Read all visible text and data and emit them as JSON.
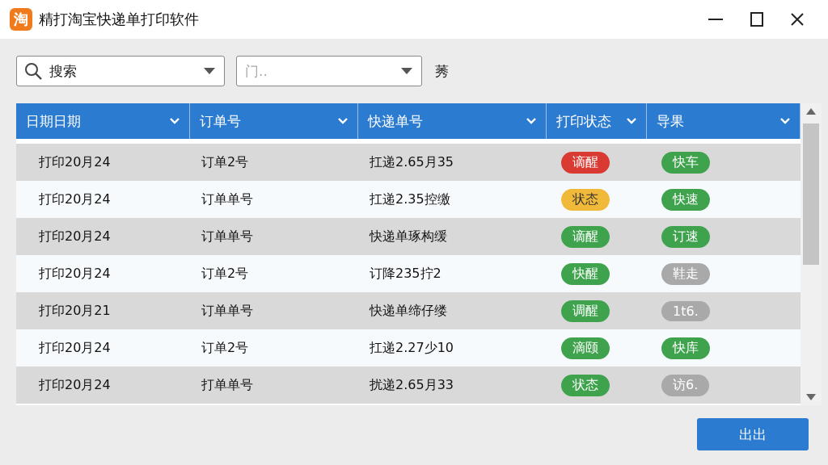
{
  "window": {
    "title": "精打淘宝快递单打印软件",
    "logo_text": "淘"
  },
  "toolbar": {
    "search": {
      "placeholder": "搜索"
    },
    "filter": {
      "placeholder": "门.."
    },
    "label": "莠"
  },
  "table": {
    "columns": [
      "日期日期",
      "订单号",
      "快递单号",
      "打印状态",
      "导果"
    ],
    "rows": [
      {
        "date": "打印20月24",
        "order": "订单2号",
        "tracking": "扛递2.65月35",
        "status": {
          "text": "谪醒",
          "color": "#d93a32"
        },
        "tag": {
          "text": "快车",
          "color": "#3fa34d"
        }
      },
      {
        "date": "打印20月24",
        "order": "订单单号",
        "tracking": "扛递2.35控缴",
        "status": {
          "text": "状态",
          "color": "#f0b93a"
        },
        "tag": {
          "text": "快速",
          "color": "#3fa34d"
        }
      },
      {
        "date": "打印20月24",
        "order": "订单单号",
        "tracking": "快递单琢构缓",
        "status": {
          "text": "谪醒",
          "color": "#3fa34d"
        },
        "tag": {
          "text": "订速",
          "color": "#3fa34d"
        }
      },
      {
        "date": "打印20月24",
        "order": "订单2号",
        "tracking": "订降235拧2",
        "status": {
          "text": "快醒",
          "color": "#3fa34d"
        },
        "tag": {
          "text": "鞋走",
          "color": "#a9a9a9"
        }
      },
      {
        "date": "打印20月21",
        "order": "订单单号",
        "tracking": "快递单缔仔缕",
        "status": {
          "text": "调醒",
          "color": "#3fa34d"
        },
        "tag": {
          "text": "1t6.",
          "color": "#a9a9a9"
        }
      },
      {
        "date": "打印20月24",
        "order": "订单2号",
        "tracking": "扛递2.27少10",
        "status": {
          "text": "滴颐",
          "color": "#3fa34d"
        },
        "tag": {
          "text": "快库",
          "color": "#3fa34d"
        }
      },
      {
        "date": "打印20月24",
        "order": "打单单号",
        "tracking": "扰递2.65月33",
        "status": {
          "text": "状态",
          "color": "#3fa34d"
        },
        "tag": {
          "text": "访6.",
          "color": "#a9a9a9"
        }
      }
    ]
  },
  "footer": {
    "button": "出出"
  }
}
